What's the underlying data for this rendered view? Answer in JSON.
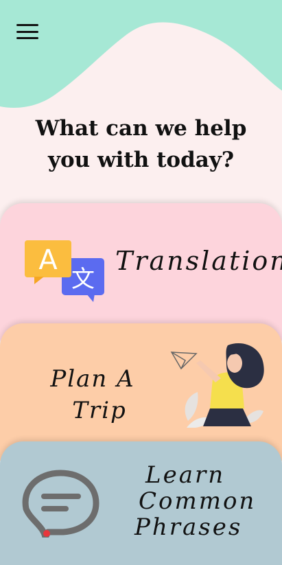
{
  "header": {
    "menu_icon": "hamburger-menu-icon",
    "wave_color": "#a6e8d5",
    "background_color": "#fcefef"
  },
  "headline": {
    "line1": "What can we help",
    "line2": "you with today?"
  },
  "cards": [
    {
      "id": "translation",
      "label": "Translation",
      "icon": "translate-icon",
      "color": "#fdd4dc"
    },
    {
      "id": "trip",
      "label_line1": "Plan A",
      "label_line2": "Trip",
      "icon": "paper-plane-person-icon",
      "color": "#fdcda8"
    },
    {
      "id": "phrases",
      "label_line1": "Learn",
      "label_line2": "Common",
      "label_line3": "Phrases",
      "icon": "chat-bubble-icon",
      "color": "#b1c9d2"
    }
  ]
}
